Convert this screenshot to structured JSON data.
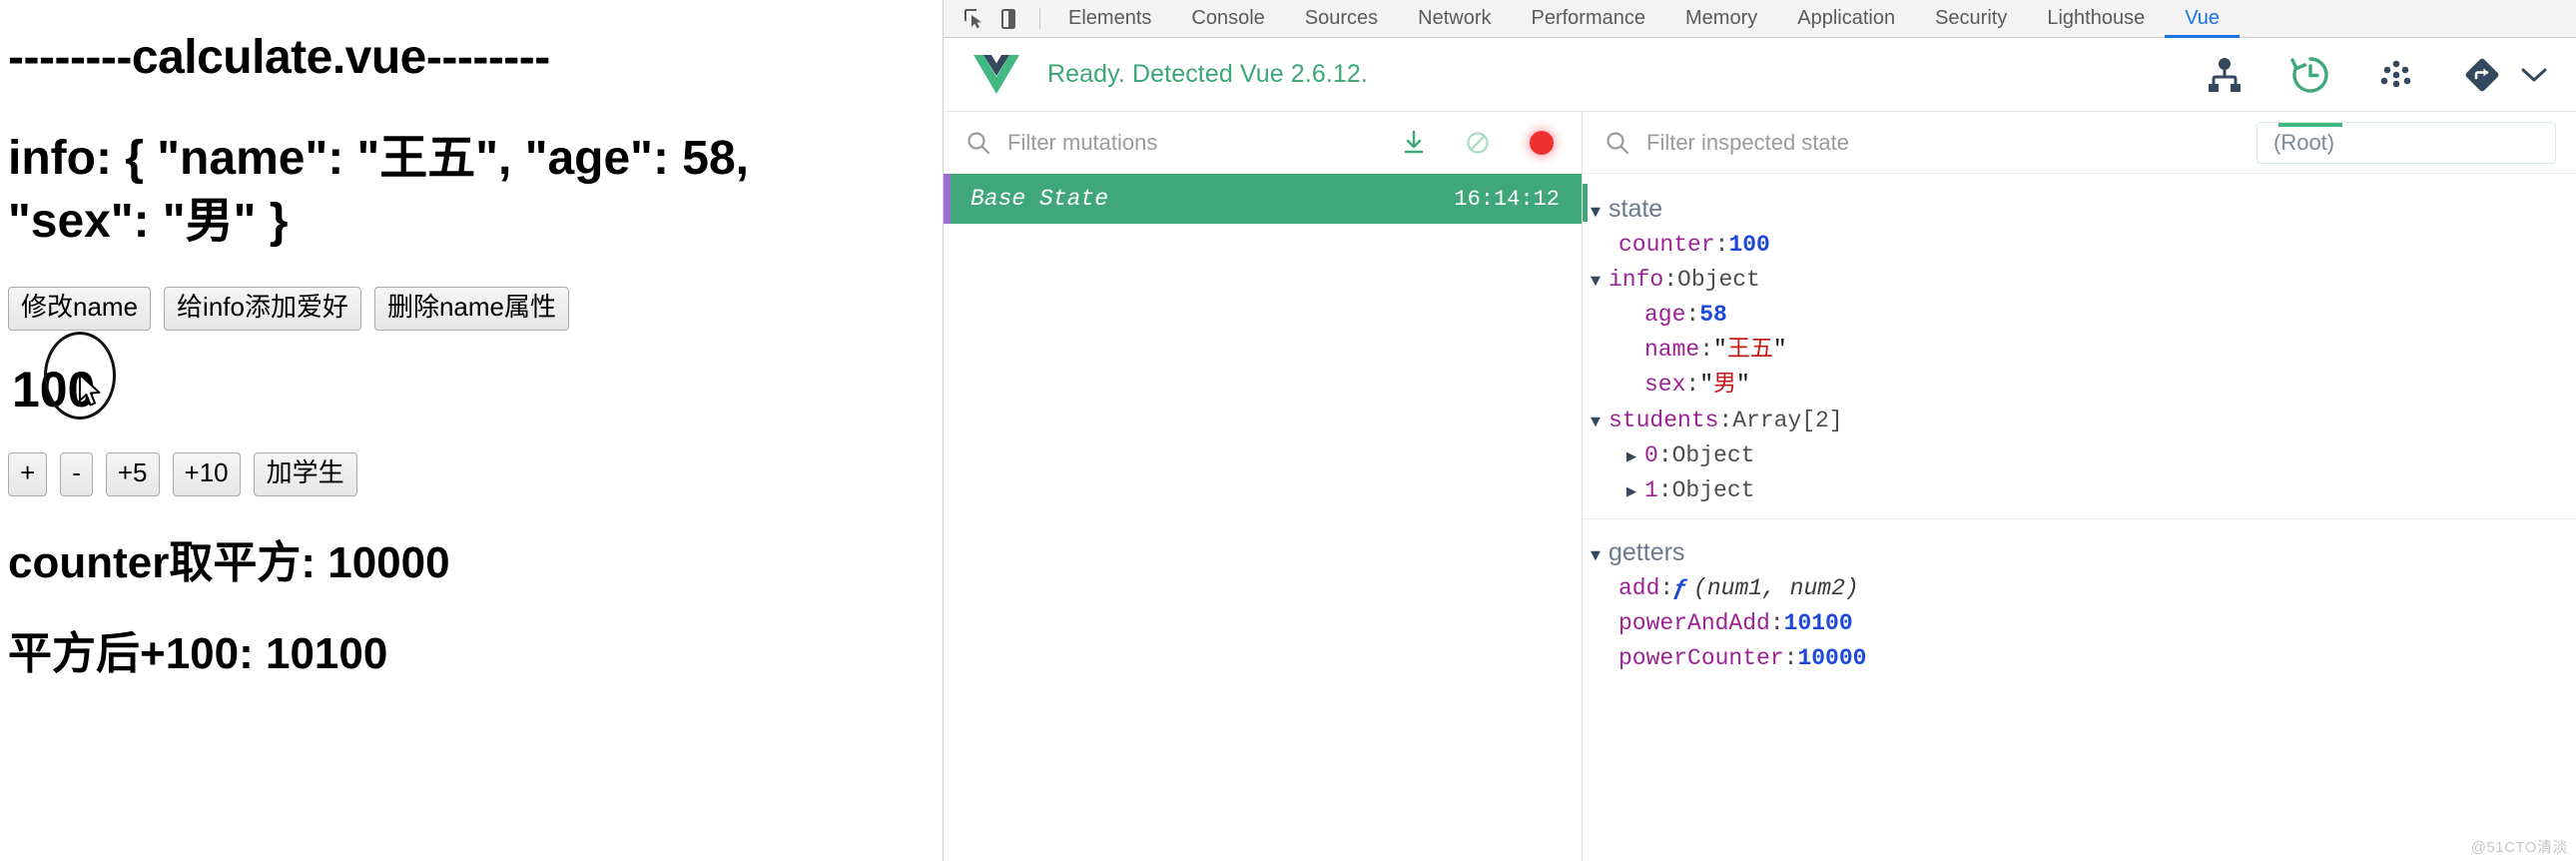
{
  "page": {
    "title": "--------calculate.vue--------",
    "info_line": "info: { \"name\": \"王五\", \"age\": 58, \"sex\": \"男\" }",
    "buttons_row1": [
      {
        "label": "修改name",
        "name": "modify-name-button"
      },
      {
        "label": "给info添加爱好",
        "name": "add-hobby-button"
      },
      {
        "label": "删除name属性",
        "name": "delete-name-button"
      }
    ],
    "counter_value": "100",
    "buttons_row2": [
      {
        "label": "+",
        "name": "increment-button"
      },
      {
        "label": "-",
        "name": "decrement-button"
      },
      {
        "label": "+5",
        "name": "add-five-button"
      },
      {
        "label": "+10",
        "name": "add-ten-button"
      },
      {
        "label": "加学生",
        "name": "add-student-button"
      }
    ],
    "power_line": "counter取平方: 10000",
    "power_add_line": "平方后+100: 10100"
  },
  "devtools": {
    "tabs": [
      {
        "label": "Elements",
        "active": false
      },
      {
        "label": "Console",
        "active": false
      },
      {
        "label": "Sources",
        "active": false
      },
      {
        "label": "Network",
        "active": false
      },
      {
        "label": "Performance",
        "active": false
      },
      {
        "label": "Memory",
        "active": false
      },
      {
        "label": "Application",
        "active": false
      },
      {
        "label": "Security",
        "active": false
      },
      {
        "label": "Lighthouse",
        "active": false
      },
      {
        "label": "Vue",
        "active": true
      }
    ],
    "active_tab": "Vue",
    "accent_color": "#1a73e8"
  },
  "vue": {
    "status": "Ready. Detected Vue 2.6.12.",
    "status_color": "#3ba776",
    "brand_green": "#42b883",
    "brand_dark": "#35495e",
    "header_icons": [
      {
        "name": "components-tree-icon",
        "active": false
      },
      {
        "name": "vuex-history-icon",
        "active": true
      },
      {
        "name": "events-icon",
        "active": false
      },
      {
        "name": "routing-icon",
        "active": false
      }
    ]
  },
  "mutations": {
    "filter_placeholder": "Filter mutations",
    "filter_value": "",
    "actions": [
      {
        "name": "export-icon"
      },
      {
        "name": "clear-icon"
      },
      {
        "name": "record-icon"
      }
    ],
    "record_color": "#f03131",
    "rows": [
      {
        "label": "Base State",
        "time": "16:14:12",
        "selected": true
      }
    ]
  },
  "inspector": {
    "filter_placeholder": "Filter inspected state",
    "filter_value": "",
    "root_select_value": "(Root)",
    "sections": [
      {
        "title": "state",
        "expanded": true,
        "nodes": [
          {
            "indent": 1,
            "arrow": "",
            "key": "counter",
            "sep": ": ",
            "value": "100",
            "vtype": "num"
          },
          {
            "indent": 0,
            "arrow": "▼",
            "key": "info",
            "sep": ": ",
            "value": "Object",
            "vtype": "type"
          },
          {
            "indent": 2,
            "arrow": "",
            "key": "age",
            "sep": ": ",
            "value": "58",
            "vtype": "num"
          },
          {
            "indent": 2,
            "arrow": "",
            "key": "name",
            "sep": ": ",
            "value": "王五",
            "vtype": "str"
          },
          {
            "indent": 2,
            "arrow": "",
            "key": "sex",
            "sep": ": ",
            "value": "男",
            "vtype": "str"
          },
          {
            "indent": 0,
            "arrow": "▼",
            "key": "students",
            "sep": ": ",
            "value": "Array[2]",
            "vtype": "type"
          },
          {
            "indent": 1,
            "arrow": "▶",
            "key": "0",
            "sep": ": ",
            "value": "Object",
            "vtype": "type"
          },
          {
            "indent": 1,
            "arrow": "▶",
            "key": "1",
            "sep": ": ",
            "value": "Object",
            "vtype": "type"
          }
        ]
      },
      {
        "title": "getters",
        "expanded": true,
        "nodes": [
          {
            "indent": 1,
            "arrow": "",
            "key": "add",
            "sep": ": ",
            "value": "(num1, num2)",
            "vtype": "fn"
          },
          {
            "indent": 1,
            "arrow": "",
            "key": "powerAndAdd",
            "sep": ": ",
            "value": "10100",
            "vtype": "num"
          },
          {
            "indent": 1,
            "arrow": "",
            "key": "powerCounter",
            "sep": ": ",
            "value": "10000",
            "vtype": "num"
          }
        ]
      }
    ]
  },
  "watermark": "@51CTO清淡"
}
